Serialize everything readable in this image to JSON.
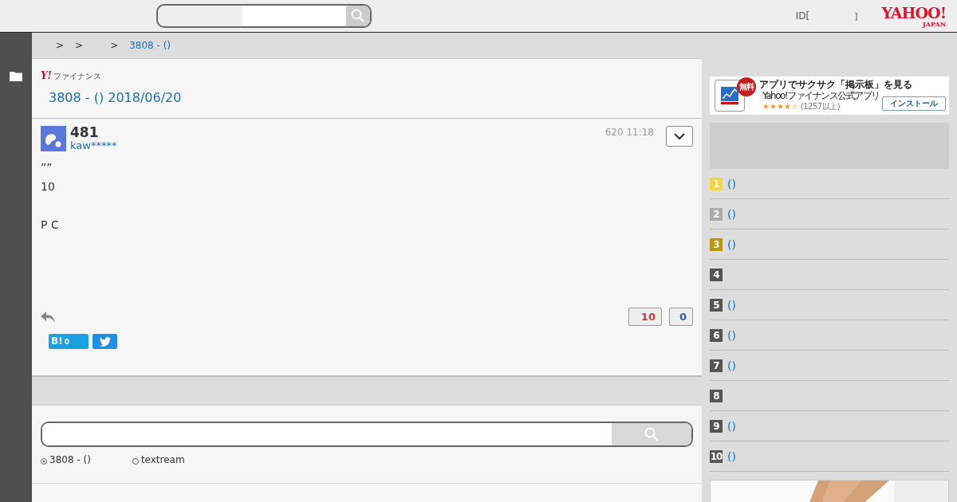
{
  "header": {
    "login_prefix": "ID[",
    "login_suffix": "]",
    "logo": "YAHOO!",
    "logo_sub": "JAPAN"
  },
  "breadcrumb": [
    {
      "label": ">"
    },
    {
      "label": ">"
    },
    {
      "label": ">"
    },
    {
      "label": "3808 - ()"
    }
  ],
  "finance_logo": {
    "mark": "Y!",
    "text": "ファイナンス"
  },
  "page_title": "3808 - () 2018/06/20",
  "post": {
    "number": "481",
    "user": "kaw*****",
    "date": "620 11:18",
    "body": "””\n10\n\nP C",
    "likes": "10",
    "dislikes": "0",
    "hatena_count": "0",
    "hatena_label": "B!"
  },
  "search": {
    "options": [
      {
        "label": "3808 - ()",
        "selected": true
      },
      {
        "label": "textream",
        "selected": false
      }
    ]
  },
  "ad": {
    "badge": "無料",
    "title": "アプリでサクサク「掲示板」を見る",
    "subtitle": "Yahoo!ファイナンス公式アプリ",
    "stars": 4,
    "reviews": "(1257以上)",
    "button": "インストール"
  },
  "ranking": [
    {
      "rank": "1",
      "label": "()",
      "color": "#f5d63d"
    },
    {
      "rank": "2",
      "label": "()",
      "color": "#aaaaaa"
    },
    {
      "rank": "3",
      "label": "()",
      "color": "#b8960c"
    },
    {
      "rank": "4",
      "color": "#555555"
    },
    {
      "rank": "5",
      "label": "()",
      "color": "#555555"
    },
    {
      "rank": "6",
      "label": "()",
      "color": "#555555"
    },
    {
      "rank": "7",
      "label": "()",
      "color": "#555555"
    },
    {
      "rank": "8",
      "color": "#555555"
    },
    {
      "rank": "9",
      "label": "()",
      "color": "#555555"
    },
    {
      "rank": "10",
      "label": "()",
      "color": "#555555"
    }
  ]
}
